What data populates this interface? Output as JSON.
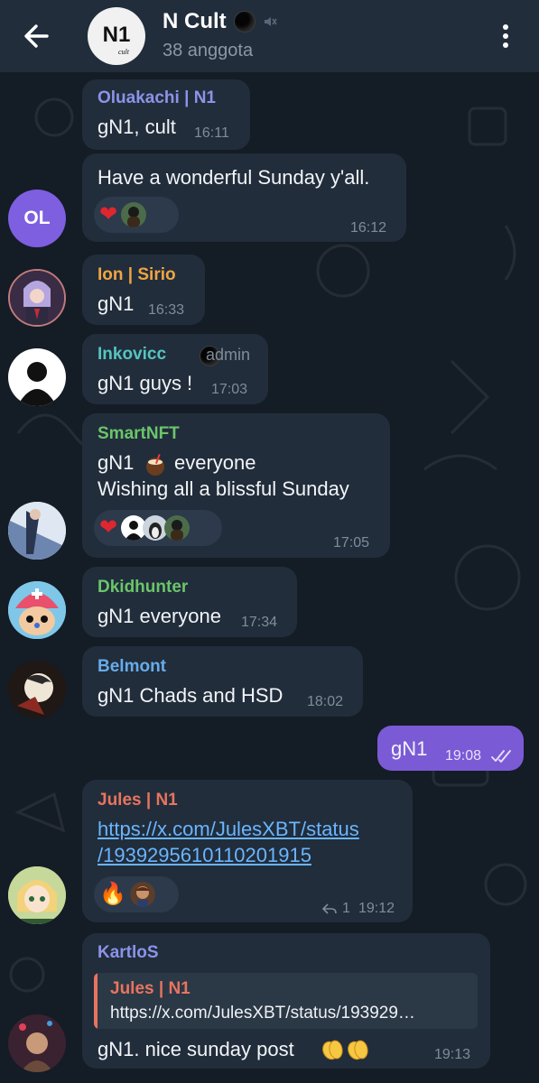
{
  "header": {
    "title": "N Cult",
    "subtitle": "38 anggota",
    "avatar_text": "N1",
    "avatar_sub": "cult"
  },
  "messages": [
    {
      "sender": "Oluakachi | N1",
      "text": "gN1, cult",
      "time": "16:11"
    },
    {
      "text": "Have a wonderful Sunday y'all.",
      "time": "16:12",
      "avatar_initials": "OL"
    },
    {
      "sender": "Ion | Sirio",
      "text": "gN1",
      "time": "16:33"
    },
    {
      "sender": "Inkovicc",
      "role": "admin",
      "text": "gN1 guys !",
      "time": "17:03"
    },
    {
      "sender": "SmartNFT",
      "text_line1_a": "gN1",
      "text_line1_b": "everyone",
      "text_line2": "Wishing all a blissful Sunday",
      "time": "17:05"
    },
    {
      "sender": "Dkidhunter",
      "text": "gN1 everyone",
      "time": "17:34"
    },
    {
      "sender": "Belmont",
      "text": "gN1 Chads and HSD",
      "time": "18:02"
    },
    {
      "outgoing": true,
      "text": "gN1",
      "time": "19:08"
    },
    {
      "sender": "Jules | N1",
      "link_line1": "https://x.com/JulesXBT/status",
      "link_line2": "/1939295610110201915",
      "replies": "1",
      "time": "19:12"
    },
    {
      "sender": "KartloS",
      "quote_sender": "Jules | N1",
      "quote_text": "https://x.com/JulesXBT/status/193929…",
      "text": "gN1. nice sunday post",
      "time": "19:13"
    }
  ],
  "colors": {
    "background": "#141c26",
    "bubble_in": "#212d3b",
    "bubble_out": "#7b5ad6",
    "time": "#7e8c9b",
    "link": "#6ab5ff"
  }
}
